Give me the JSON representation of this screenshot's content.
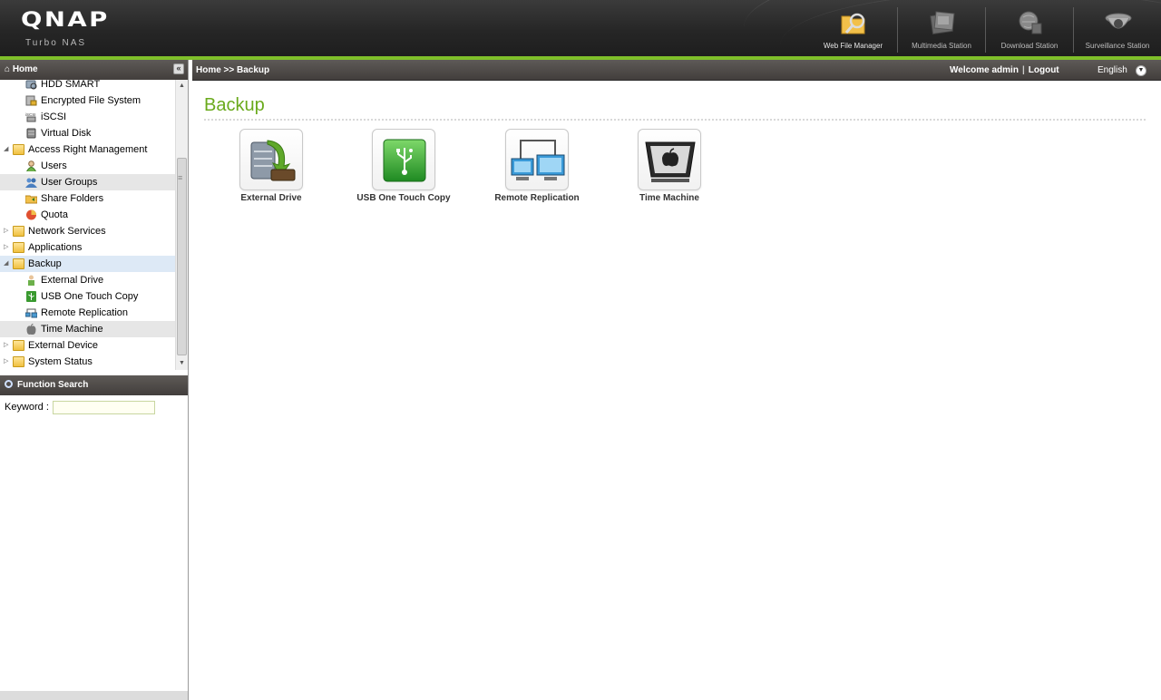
{
  "header": {
    "brand": "QNAP",
    "subtitle": "Turbo NAS",
    "apps": [
      {
        "label": "Web File Manager",
        "icon": "web-file-manager-icon"
      },
      {
        "label": "Multimedia Station",
        "icon": "multimedia-station-icon"
      },
      {
        "label": "Download Station",
        "icon": "download-station-icon"
      },
      {
        "label": "Surveillance Station",
        "icon": "surveillance-station-icon"
      }
    ]
  },
  "sidebar": {
    "title": "Home",
    "tree": [
      {
        "label": "HDD SMART",
        "icon": "hdd-smart-icon"
      },
      {
        "label": "Encrypted File System",
        "icon": "encrypted-file-system-icon"
      },
      {
        "label": "iSCSI",
        "icon": "iscsi-icon"
      },
      {
        "label": "Virtual Disk",
        "icon": "virtual-disk-icon"
      },
      {
        "label": "Access Right Management",
        "icon": "folder-open-icon"
      },
      {
        "label": "Users",
        "icon": "users-icon"
      },
      {
        "label": "User Groups",
        "icon": "user-groups-icon"
      },
      {
        "label": "Share Folders",
        "icon": "share-folders-icon"
      },
      {
        "label": "Quota",
        "icon": "quota-icon"
      },
      {
        "label": "Network Services",
        "icon": "folder-icon"
      },
      {
        "label": "Applications",
        "icon": "folder-icon"
      },
      {
        "label": "Backup",
        "icon": "folder-open-icon"
      },
      {
        "label": "External Drive",
        "icon": "external-drive-icon"
      },
      {
        "label": "USB One Touch Copy",
        "icon": "usb-icon"
      },
      {
        "label": "Remote Replication",
        "icon": "remote-replication-icon"
      },
      {
        "label": "Time Machine",
        "icon": "apple-icon"
      },
      {
        "label": "External Device",
        "icon": "folder-icon"
      },
      {
        "label": "System Status",
        "icon": "folder-icon"
      }
    ]
  },
  "search": {
    "title": "Function Search",
    "keyword_label": "Keyword :",
    "keyword_value": ""
  },
  "topbar": {
    "breadcrumb": "Home >> Backup",
    "welcome": "Welcome admin",
    "separator": "|",
    "logout": "Logout",
    "language": "English"
  },
  "main": {
    "title": "Backup",
    "tiles": [
      {
        "label": "External Drive",
        "icon": "external-drive-icon"
      },
      {
        "label": "USB One Touch Copy",
        "icon": "usb-one-touch-copy-icon"
      },
      {
        "label": "Remote Replication",
        "icon": "remote-replication-icon"
      },
      {
        "label": "Time Machine",
        "icon": "time-machine-icon"
      }
    ]
  },
  "colors": {
    "accent_green": "#7fbf2a",
    "title_green": "#6aaa1c",
    "header_dark": "#262626"
  }
}
